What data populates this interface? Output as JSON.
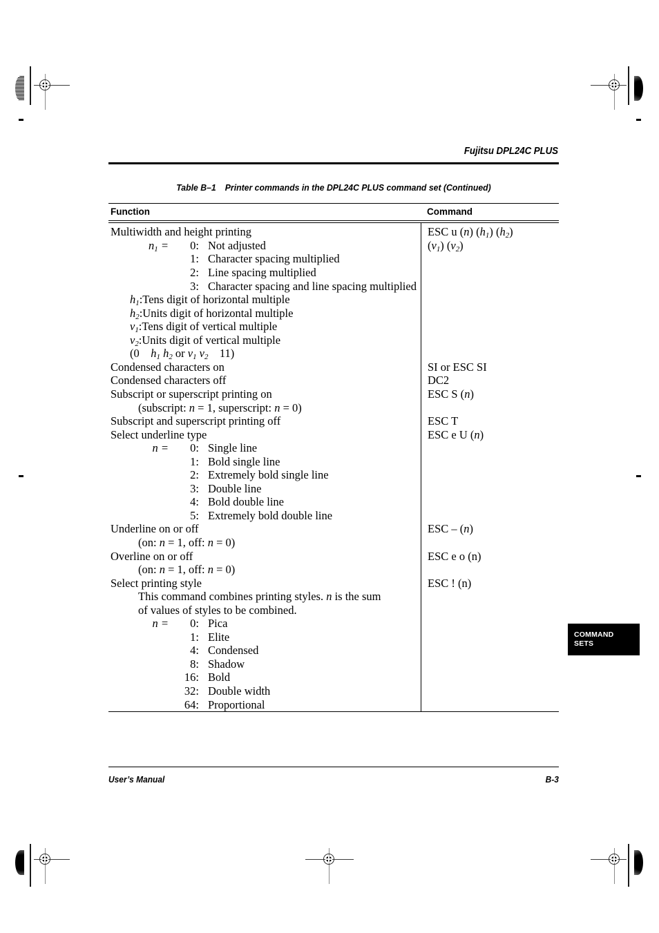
{
  "page": {
    "running_head": "Fujitsu DPL24C PLUS",
    "table_caption_number": "Table B–1",
    "table_caption_text": "Printer commands in the DPL24C PLUS command set (Continued)",
    "thumb_tab_line1": "COMMAND",
    "thumb_tab_line2": "SETS",
    "footer_left": "User’s Manual",
    "footer_right": "B-3"
  },
  "table": {
    "headers": {
      "function": "Function",
      "command": "Command"
    },
    "function_column": [
      {
        "text": "Multiwidth and height printing",
        "indent": 0
      },
      {
        "key": "n1 =",
        "num": "0:",
        "label": "Not adjusted",
        "type": "opt"
      },
      {
        "key": "",
        "num": "1:",
        "label": "Character spacing multiplied",
        "type": "opt"
      },
      {
        "key": "",
        "num": "2:",
        "label": "Line spacing multiplied",
        "type": "opt"
      },
      {
        "key": "",
        "num": "3:",
        "label": "Character spacing and line spacing multiplied",
        "type": "opt"
      },
      {
        "text": "h1:Tens digit of horizontal multiple",
        "indent": 1
      },
      {
        "text": "h2:Units digit of horizontal multiple",
        "indent": 1
      },
      {
        "text": "v1:Tens digit of vertical multiple",
        "indent": 1
      },
      {
        "text": "v2:Units digit of vertical multiple",
        "indent": 1
      },
      {
        "text": "(0    h1 h2 or v1 v2    11)",
        "indent": 1
      },
      {
        "text": "Condensed characters on",
        "indent": 0
      },
      {
        "text": "Condensed characters off",
        "indent": 0
      },
      {
        "text": "Subscript or superscript printing on",
        "indent": 0
      },
      {
        "text": "(subscript: n = 1, superscript: n = 0)",
        "indent": 1
      },
      {
        "text": "Subscript and superscript printing off",
        "indent": 0
      },
      {
        "text": "Select underline type",
        "indent": 0
      },
      {
        "key": "n =",
        "num": "0:",
        "label": "Single line",
        "type": "opt"
      },
      {
        "key": "",
        "num": "1:",
        "label": "Bold single line",
        "type": "opt"
      },
      {
        "key": "",
        "num": "2:",
        "label": "Extremely bold single line",
        "type": "opt"
      },
      {
        "key": "",
        "num": "3:",
        "label": "Double line",
        "type": "opt"
      },
      {
        "key": "",
        "num": "4:",
        "label": "Bold double line",
        "type": "opt"
      },
      {
        "key": "",
        "num": "5:",
        "label": "Extremely bold double line",
        "type": "opt"
      },
      {
        "text": "Underline on or off",
        "indent": 0
      },
      {
        "text": "(on: n = 1, off: n = 0)",
        "indent": 1
      },
      {
        "text": "Overline on or off",
        "indent": 0
      },
      {
        "text": "(on: n = 1, off: n = 0)",
        "indent": 1
      },
      {
        "text": "Select printing style",
        "indent": 0
      },
      {
        "text": "This command combines printing styles. n is the sum",
        "indent": 1
      },
      {
        "text": "of values of styles to be combined.",
        "indent": 1
      },
      {
        "key": "n =",
        "num": "0:",
        "label": "Pica",
        "type": "opt"
      },
      {
        "key": "",
        "num": "1:",
        "label": "Elite",
        "type": "opt"
      },
      {
        "key": "",
        "num": "4:",
        "label": "Condensed",
        "type": "opt"
      },
      {
        "key": "",
        "num": "8:",
        "label": "Shadow",
        "type": "opt"
      },
      {
        "key": "",
        "num": "16:",
        "label": "Bold",
        "type": "opt"
      },
      {
        "key": "",
        "num": "32:",
        "label": "Double width",
        "type": "opt"
      },
      {
        "key": "",
        "num": "64:",
        "label": "Proportional",
        "type": "opt"
      }
    ],
    "command_column": [
      "ESC u (n) (h1) (h2)",
      "(v1) (v2)",
      "SI or ESC SI",
      "DC2",
      "ESC S (n)",
      "ESC T",
      "ESC e U (n)",
      "ESC – (n)",
      "ESC e o (n)",
      "ESC ! (n)"
    ]
  }
}
